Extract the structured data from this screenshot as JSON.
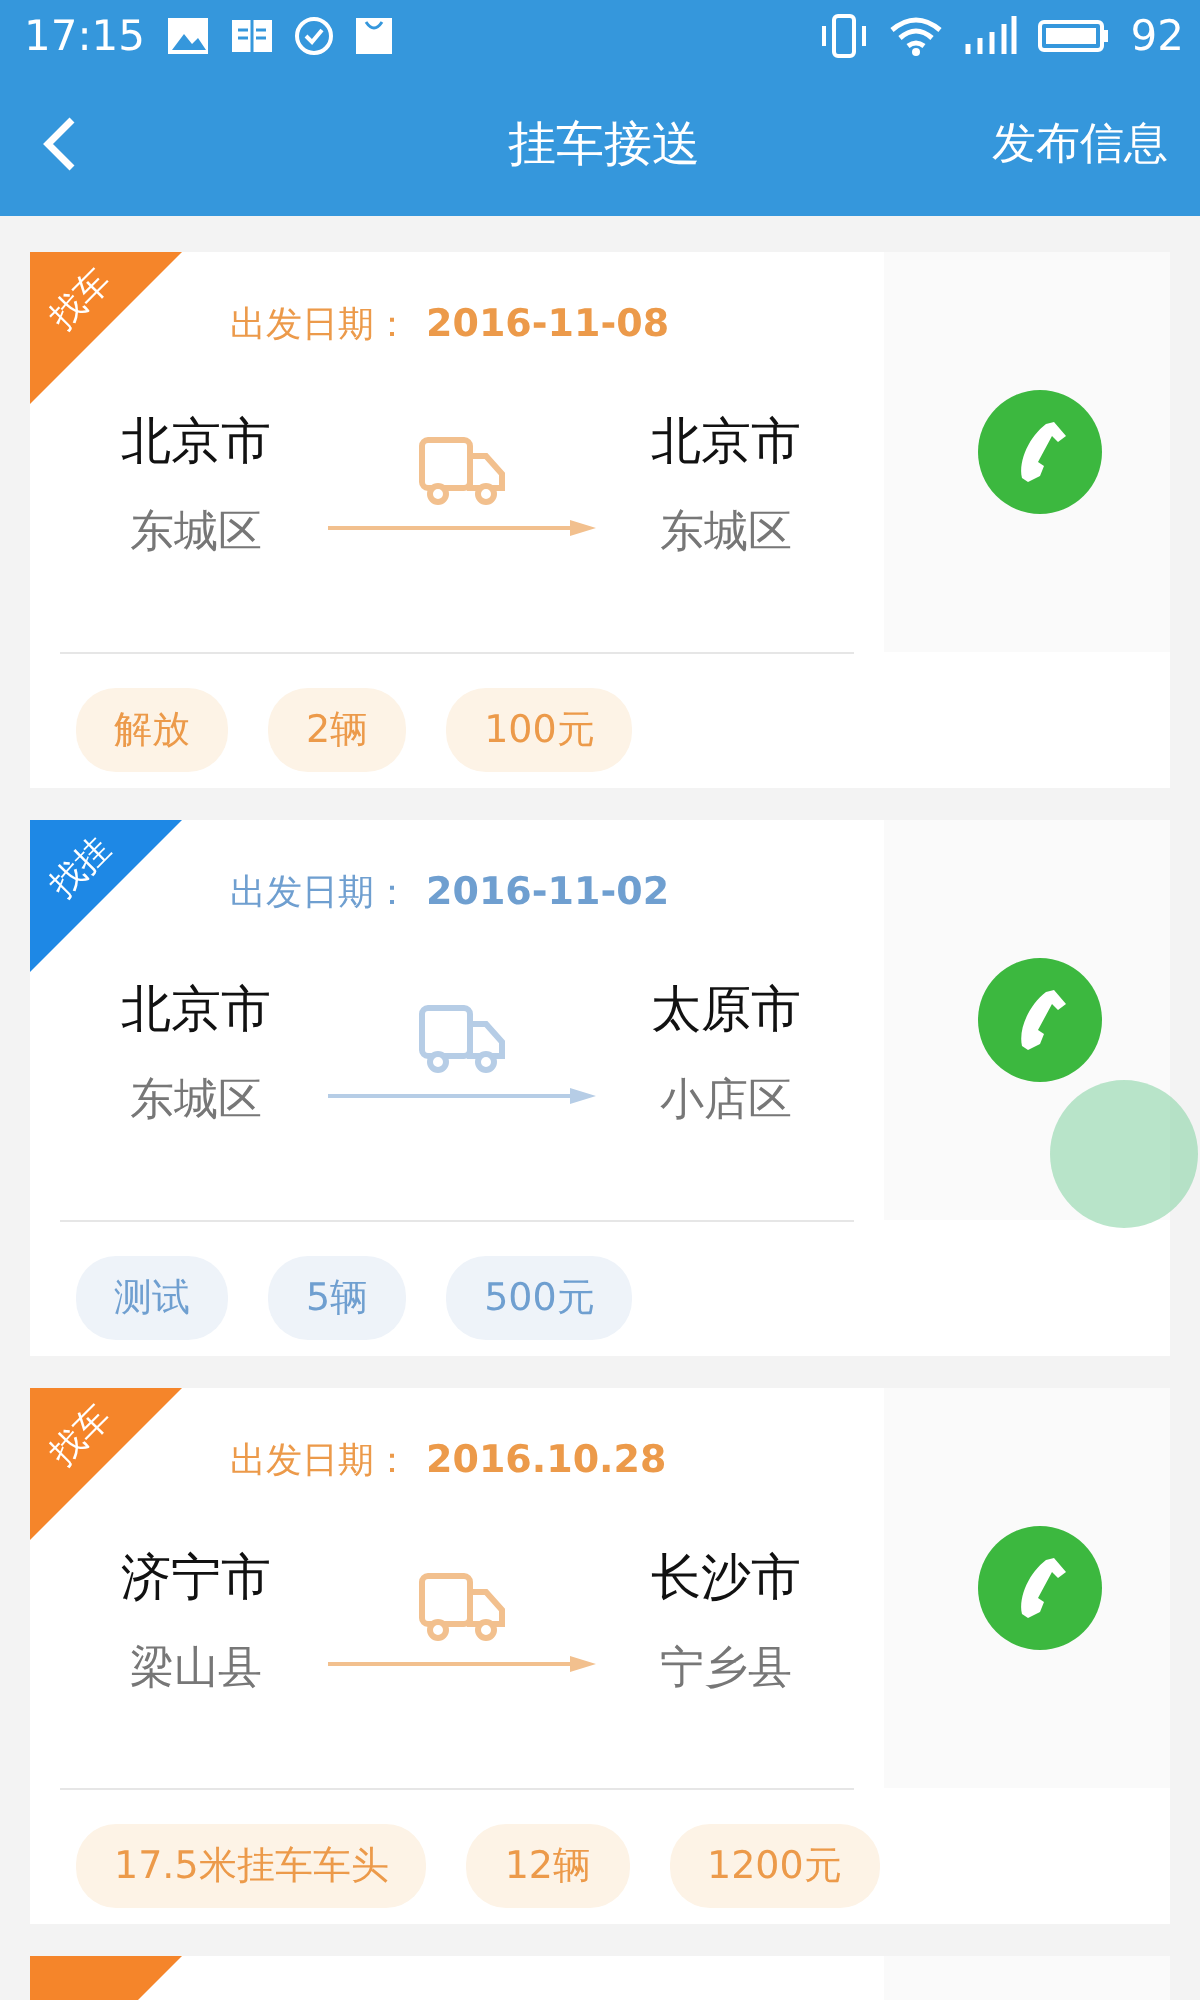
{
  "status_bar": {
    "time": "17:15",
    "battery": "92"
  },
  "nav": {
    "title": "挂车接送",
    "action": "发布信息"
  },
  "cards": [
    {
      "kind": "find_car",
      "tag": "找车",
      "date_label": "出发日期：",
      "date": "2016-11-08",
      "from_city": "北京市",
      "from_district": "东城区",
      "to_city": "北京市",
      "to_district": "东城区",
      "chips": [
        "解放",
        "2辆",
        "100元"
      ]
    },
    {
      "kind": "find_trailer",
      "tag": "找挂",
      "date_label": "出发日期：",
      "date": "2016-11-02",
      "from_city": "北京市",
      "from_district": "东城区",
      "to_city": "太原市",
      "to_district": "小店区",
      "chips": [
        "测试",
        "5辆",
        "500元"
      ]
    },
    {
      "kind": "find_car",
      "tag": "找车",
      "date_label": "出发日期：",
      "date": "2016.10.28",
      "from_city": "济宁市",
      "from_district": "梁山县",
      "to_city": "长沙市",
      "to_district": "宁乡县",
      "chips": [
        "17.5米挂车车头",
        "12辆",
        "1200元"
      ]
    },
    {
      "kind": "find_car"
    }
  ],
  "touch_indicator": true
}
